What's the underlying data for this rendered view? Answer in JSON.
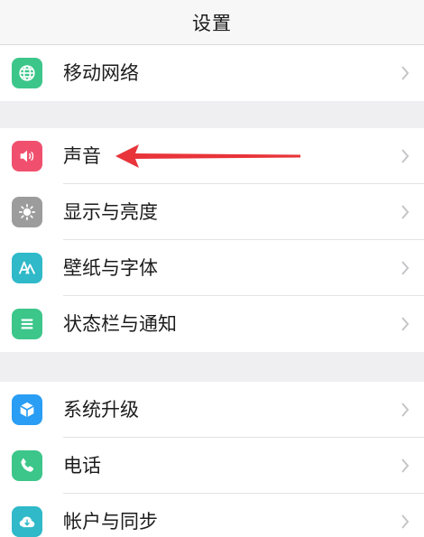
{
  "header": {
    "title": "设置"
  },
  "colors": {
    "network": "#3cc68a",
    "sound": "#f0506e",
    "display": "#9c9c9c",
    "wallpaper": "#2fb9c9",
    "statusbar": "#3cc68a",
    "upgrade": "#2a9df4",
    "phone": "#3cc68a",
    "account": "#2fb9c9",
    "annotation_arrow": "#e8343a"
  },
  "groups": [
    {
      "items": [
        {
          "label": "移动网络",
          "icon": "globe-icon"
        }
      ]
    },
    {
      "items": [
        {
          "label": "声音",
          "icon": "speaker-icon"
        },
        {
          "label": "显示与亮度",
          "icon": "sun-icon"
        },
        {
          "label": "壁纸与字体",
          "icon": "letter-a-icon"
        },
        {
          "label": "状态栏与通知",
          "icon": "list-icon"
        }
      ]
    },
    {
      "items": [
        {
          "label": "系统升级",
          "icon": "cube-icon"
        },
        {
          "label": "电话",
          "icon": "phone-icon"
        },
        {
          "label": "帐户与同步",
          "icon": "cloud-sync-icon"
        }
      ]
    }
  ]
}
